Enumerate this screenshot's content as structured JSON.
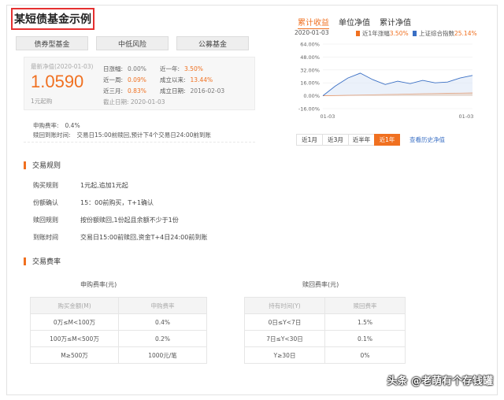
{
  "title": "某短债基金示例",
  "tags": [
    "债券型基金",
    "中低风险",
    "公募基金"
  ],
  "nav": {
    "date_label": "最新净值(2020-01-03)",
    "value": "1.0590",
    "min_buy": "1元起购"
  },
  "stats": {
    "day_label": "日涨幅:",
    "day_value": "0.00%",
    "week_label": "近一周:",
    "week_value": "0.09%",
    "m3_label": "近三月:",
    "m3_value": "0.83%",
    "deadline": "截止日期:  2020-01-03",
    "y1_label": "近一年:",
    "y1_value": "3.50%",
    "since_label": "成立以来:",
    "since_value": "13.44%",
    "est_label": "成立日期:",
    "est_value": "2016-02-03"
  },
  "fees_summary": {
    "buy_label": "申购费率:",
    "buy_value": "0.4%",
    "redeem_label": "赎回到账时间:",
    "redeem_value": "交易日15:00前赎回,预计下4个交易日24:00前到账"
  },
  "chart_tabs": [
    "累计收益",
    "单位净值",
    "累计净值"
  ],
  "chart_date": "2020-01-03",
  "legend": {
    "fund_label": "近1年涨幅",
    "fund_value": "3.50%",
    "fund_color": "#f07020",
    "index_label": "上证综合指数",
    "index_value": "25.14%",
    "index_color": "#3a6fc4"
  },
  "range_buttons": [
    "近1月",
    "近3月",
    "近半年",
    "近1年"
  ],
  "history_link": "查看历史净值",
  "chart_data": {
    "type": "area",
    "y_ticks": [
      "64.00%",
      "48.00%",
      "32.00%",
      "16.00%",
      "0.00%",
      "-16.00%"
    ],
    "x_ticks": [
      "01-03",
      "01-03"
    ],
    "ylim": [
      -16,
      64
    ],
    "series": [
      {
        "name": "近1年涨幅",
        "color": "#f07020",
        "values": [
          0,
          0.3,
          0.6,
          0.9,
          1.2,
          1.5,
          1.8,
          2.1,
          2.4,
          2.7,
          3.0,
          3.2,
          3.5
        ]
      },
      {
        "name": "上证综合指数",
        "color": "#3a6fc4",
        "values": [
          0,
          12,
          22,
          28,
          20,
          14,
          18,
          15,
          19,
          16,
          17,
          22,
          25.14
        ]
      }
    ]
  },
  "trade_rules": {
    "title": "交易规则",
    "rows": [
      {
        "label": "购买规则",
        "value": "1元起,追加1元起"
      },
      {
        "label": "份额确认",
        "value": "15：00前购买，T+1确认"
      },
      {
        "label": "赎回规则",
        "value": "按份额赎回,1份起且余额不少于1份"
      },
      {
        "label": "到账时间",
        "value": "交易日15:00前赎回,资金T+4日24:00前到账"
      }
    ]
  },
  "fee_rates": {
    "title": "交易费率",
    "buy": {
      "heading": "申购费率(元)",
      "columns": [
        "购买金额(M)",
        "申购费率"
      ],
      "rows": [
        [
          "0万≤M<100万",
          "0.4%"
        ],
        [
          "100万≤M<500万",
          "0.2%"
        ],
        [
          "M≥500万",
          "1000元/笔"
        ]
      ]
    },
    "redeem": {
      "heading": "赎回费率(元)",
      "columns": [
        "持有时间(Y)",
        "赎回费率"
      ],
      "rows": [
        [
          "0日≤Y<7日",
          "1.5%"
        ],
        [
          "7日≤Y<30日",
          "0.1%"
        ],
        [
          "Y≥30日",
          "0%"
        ]
      ]
    }
  },
  "watermark": "头条 @老萌有个存钱罐"
}
